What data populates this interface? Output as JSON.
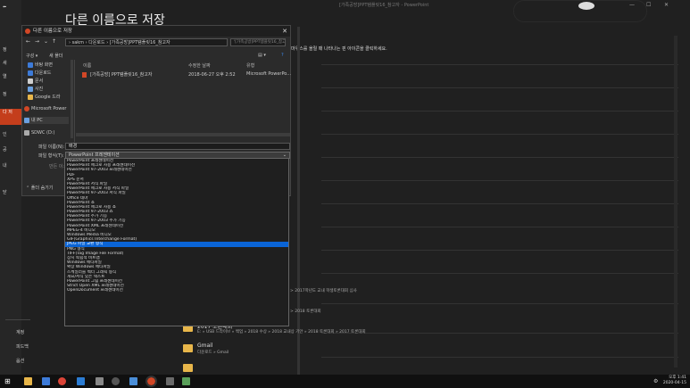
{
  "backstage": {
    "title": "다른 이름으로 저장",
    "window_title": "[가족공방]PPT템플릿16_참고자",
    "app_name": "PowerPoint",
    "instruction": "마우스를 올릴 때 나타나는 핀 아이콘을 클릭하세요.",
    "left_items": [
      "정",
      "새",
      "열",
      "정",
      "다 저",
      "인",
      "공",
      "내",
      "닫"
    ],
    "bottom_items": [
      "계정",
      "피드백",
      "옵션"
    ],
    "recent_folders": [
      {
        "name": "",
        "path": "> 2017학년도 교내 학생토론대회 심사"
      },
      {
        "name": "",
        "path": "> 2018 토론대회"
      },
      {
        "name": "2017 토론대회",
        "path": "E: » USB 드라이브 » 백업 » 2018 수상 » 2018 교내상 기안 » 2018 토론대회 » 2017 토론대회"
      },
      {
        "name": "Gmail",
        "path": "다운로드 » Gmail"
      },
      {
        "name": "",
        "path": ""
      }
    ]
  },
  "dialog": {
    "title": "다른 이름으로 저장",
    "close": "✕",
    "address": "› sakm › 다운로드 › [가족공방]PPT템플릿16_참고자",
    "search_placeholder": "'[가족공방]PPT템플릿16_참고...",
    "organize": "구성 ▾",
    "new_folder": "새 폴더",
    "nav_items": [
      {
        "label": "바탕 화면",
        "color": "#3d7bd9"
      },
      {
        "label": "다운로드",
        "color": "#3d7bd9"
      },
      {
        "label": "문서",
        "color": "#cfcfcf"
      },
      {
        "label": "사진",
        "color": "#6aa0e0"
      },
      {
        "label": "Google 드라",
        "color": "#e8b64a"
      },
      {
        "label": "Microsoft Power",
        "color": "#d24726"
      },
      {
        "label": "내 PC",
        "color": "#6aa0e0"
      },
      {
        "label": "SDWC (D:)",
        "color": "#aaaaaa"
      }
    ],
    "columns": {
      "name": "이름",
      "date": "수정한 날짜",
      "type": "유형"
    },
    "files": [
      {
        "name": "[가족공방] PPT템플릿16_참고자",
        "date": "2018-06-27 오후 2:52",
        "type": "Microsoft PowerPo..."
      }
    ],
    "filename_label": "파일 이름(N):",
    "filename_value": "배경",
    "filetype_label": "파일 형식(T):",
    "filetype_value": "PowerPoint 프레젠테이션",
    "author_label": "만든 이:",
    "hide_folders": "폴더 숨기기"
  },
  "filetype_options": [
    "PowerPoint 프레젠테이션",
    "PowerPoint 매크로 사용 프레젠테이션",
    "PowerPoint 97-2003 프레젠테이션",
    "PDF",
    "XPS 문서",
    "PowerPoint 서식 파일",
    "PowerPoint 매크로 사용 서식 파일",
    "PowerPoint 97-2003 서식 파일",
    "Office 테마",
    "PowerPoint 쇼",
    "PowerPoint 매크로 사용 쇼",
    "PowerPoint 97-2003 쇼",
    "PowerPoint 추가 기능",
    "PowerPoint 97-2003 추가 기능",
    "PowerPoint XML 프레젠테이션",
    "MPEG-4 비디오",
    "Windows Media 비디오",
    "GIF(Graphics Interchange Format)",
    "JPEG 파일 교환 형식",
    "PNG 형식",
    "TIFF(Tag Image File Format)",
    "장치 독립적 비트맵",
    "Windows 메타파일",
    "확장 Windows 메타파일",
    "스케일러블 벡터 그래픽 형식",
    "개요/서식 있는 텍스트",
    "PowerPoint 그림 프레젠테이션",
    "Strict Open XML 프레젠테이션",
    "OpenDocument 프레젠테이션"
  ],
  "selected_option_index": 18,
  "taskbar": {
    "time": "오후 1:41",
    "date": "2020-04-15"
  },
  "colors": {
    "accent": "#c43e1c",
    "selection": "#0a64d6"
  }
}
